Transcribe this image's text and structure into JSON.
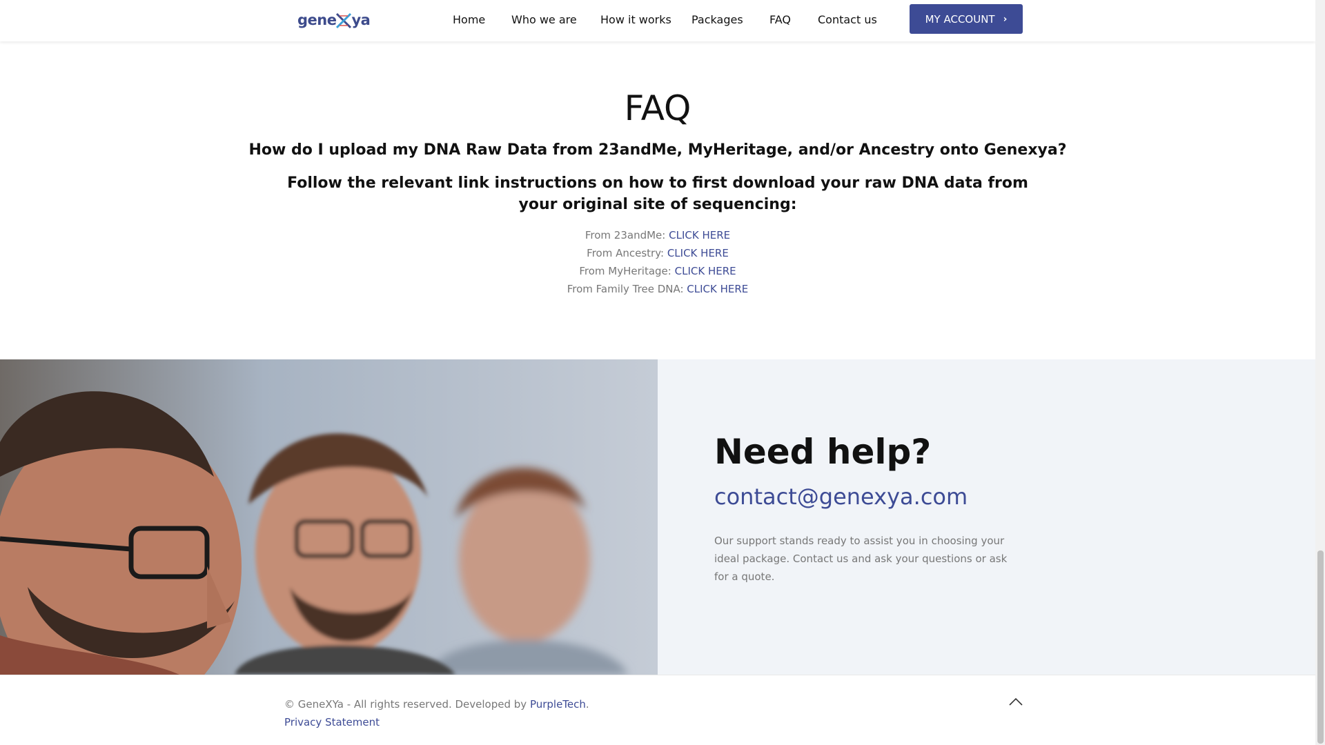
{
  "header": {
    "logo": {
      "part1": "gene",
      "part2": "ya",
      "logo_icon": "dna-x-icon"
    },
    "nav": [
      "Home",
      "Who we are",
      "How it works",
      "Packages",
      "FAQ",
      "Contact us"
    ],
    "account_label": "MY ACCOUNT",
    "account_icon": "chevron-right-icon"
  },
  "faq": {
    "title": "FAQ",
    "question": "How do I upload my DNA Raw Data from 23andMe, MyHeritage, and/or Ancestry onto Genexya?",
    "answer": "Follow the relevant link instructions on how to first download your raw DNA data from your original site of sequencing:",
    "links": [
      {
        "label": "From 23andMe:",
        "link": "CLICK HERE"
      },
      {
        "label": "From Ancestry:",
        "link": "CLICK HERE"
      },
      {
        "label": "From MyHeritage:",
        "link": "CLICK HERE"
      },
      {
        "label": "From Family Tree DNA:",
        "link": "CLICK HERE"
      }
    ]
  },
  "help": {
    "title": "Need help?",
    "email": "contact@genexya.com",
    "text": "Our support stands ready to assist you in choosing your ideal package. Contact us and ask your questions or ask for a quote."
  },
  "footer": {
    "copyright_prefix": "© GeneXYa - All rights reserved. Developed by ",
    "developer": "PurpleTech",
    "copyright_suffix": ".",
    "privacy": "Privacy Statement",
    "to_top_icon": "chevron-up-icon"
  },
  "colors": {
    "accent": "#3d4b95",
    "panel_bg": "#f1f4f8",
    "muted_text": "#777777"
  }
}
